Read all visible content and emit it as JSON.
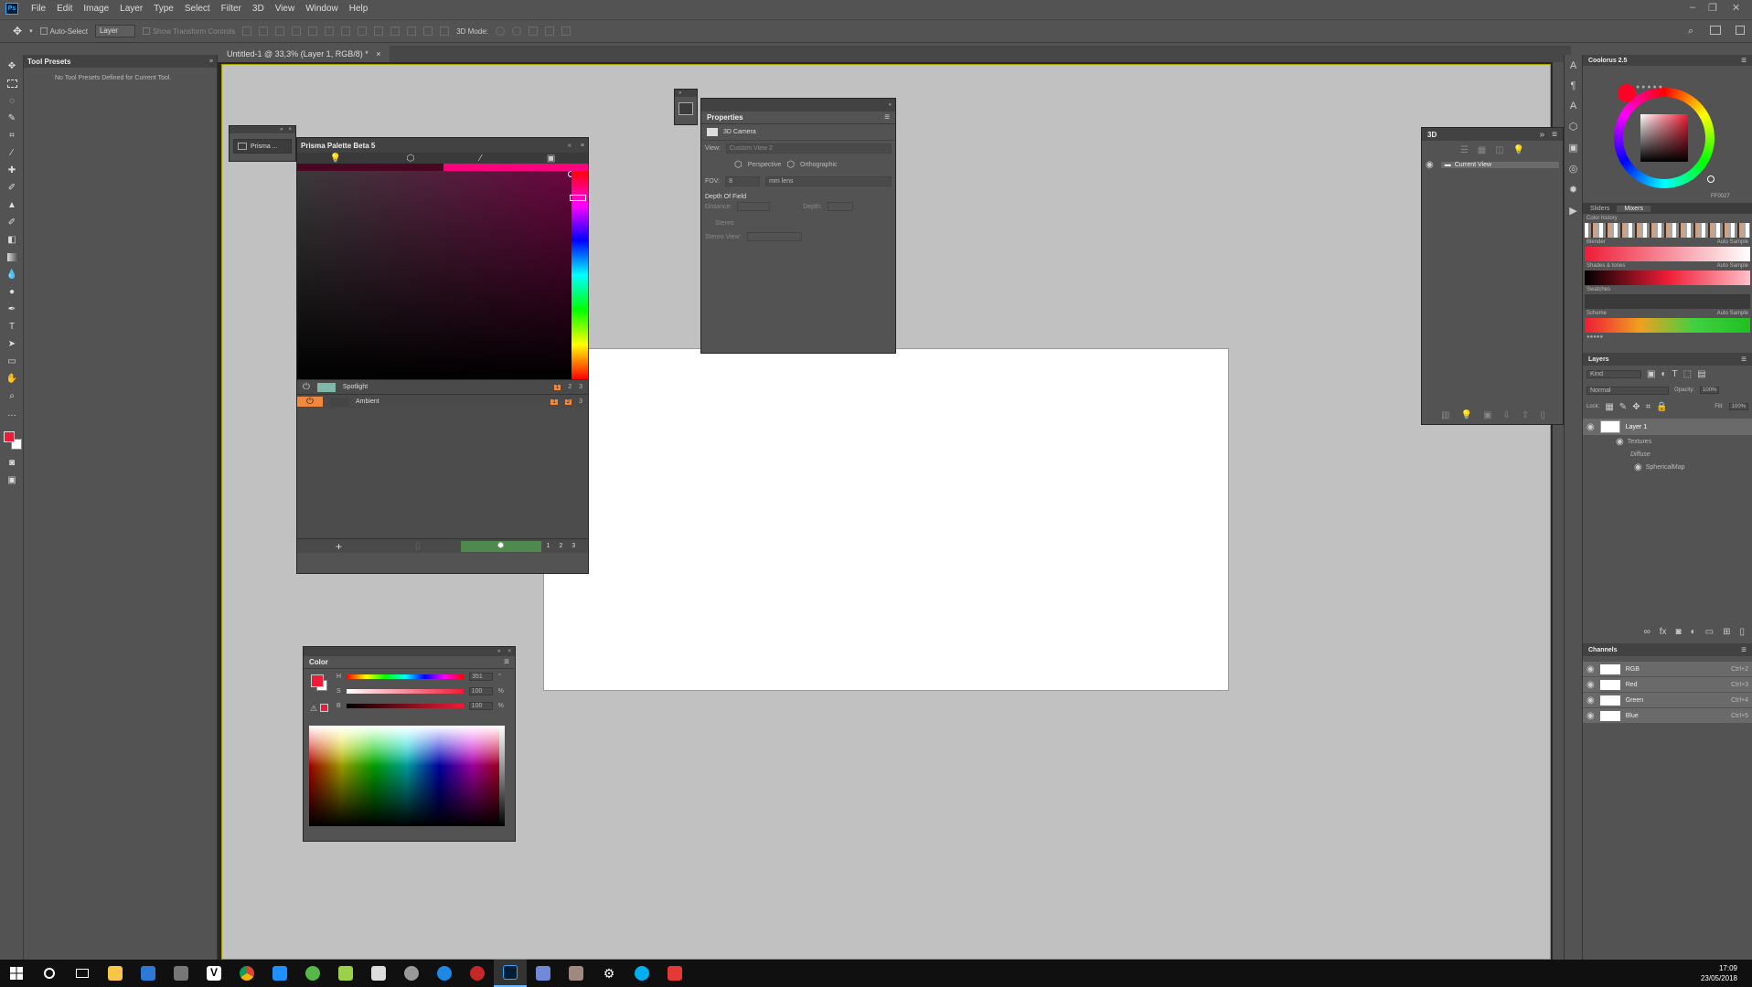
{
  "app": {
    "logo": "Ps"
  },
  "menu": [
    "File",
    "Edit",
    "Image",
    "Layer",
    "Type",
    "Select",
    "Filter",
    "3D",
    "View",
    "Window",
    "Help"
  ],
  "options": {
    "auto_select": "Auto-Select",
    "layer_select": "Layer",
    "transform": "Show Transform Controls",
    "mode_3d": "3D Mode:"
  },
  "document_tab": {
    "title": "Untitled-1 @ 33,3% (Layer 1, RGB/8) *",
    "close": "×"
  },
  "tool_presets": {
    "title": "Tool Presets",
    "message": "No Tool Presets Defined for Current Tool."
  },
  "prisma": {
    "mini_label": "Prisma ...",
    "title": "Prisma Palette Beta 5",
    "lights": [
      {
        "name": "Spotlight",
        "nums": [
          "1",
          "2",
          "3"
        ]
      },
      {
        "name": "Ambient",
        "nums": [
          "1",
          "2",
          "3"
        ]
      }
    ],
    "footer_nums": [
      "1",
      "2",
      "3"
    ],
    "colors": {
      "accent": "#ff007f",
      "orange": "#f0883e",
      "green": "#4e8a4e",
      "swatch": "#7fb8a8"
    }
  },
  "properties": {
    "title": "Properties",
    "section": "3D Camera",
    "view_label": "View:",
    "view_value": "Custom View 2",
    "perspective": "Perspective",
    "orthographic": "Orthographic",
    "fov_label": "FOV:",
    "fov_value": "8",
    "fov_unit": "mm lens",
    "dof": "Depth Of Field",
    "distance": "Distance:",
    "depth": "Depth:",
    "stereo": "Stereo",
    "stereo_view": "Stereo View:"
  },
  "panel3d": {
    "title": "3D",
    "item": "Current View"
  },
  "color_panel": {
    "title": "Color",
    "h_label": "H",
    "h_value": "351",
    "h_unit": "°",
    "s_label": "S",
    "s_value": "100",
    "s_unit": "%",
    "b_label": "B",
    "b_value": "100",
    "b_unit": "%",
    "foreground": "#ee1c36"
  },
  "coolorus": {
    "title": "Coolorus 2.5",
    "hex": "FF0027",
    "tabs": [
      "Sliders",
      "Mixers"
    ],
    "color_history": "Color history",
    "blender": "Blender",
    "shades": "Shades & tones",
    "swatches": "Swatches",
    "scheme": "Scheme",
    "auto_sample": "Auto Sample"
  },
  "layers": {
    "title": "Layers",
    "kind": "Kind",
    "blend": "Normal",
    "opacity_label": "Opacity:",
    "opacity_value": "100%",
    "lock_label": "Lock:",
    "fill_label": "Fill:",
    "fill_value": "100%",
    "items": [
      "Layer 1",
      "Textures",
      "Diffuse",
      "SphericalMap"
    ]
  },
  "channels": {
    "title": "Channels",
    "items": [
      {
        "name": "RGB",
        "key": "Ctrl+2"
      },
      {
        "name": "Red",
        "key": "Ctrl+3"
      },
      {
        "name": "Green",
        "key": "Ctrl+4"
      },
      {
        "name": "Blue",
        "key": "Ctrl+5"
      }
    ]
  },
  "taskbar": {
    "time": "17:09",
    "date": "23/05/2018"
  }
}
